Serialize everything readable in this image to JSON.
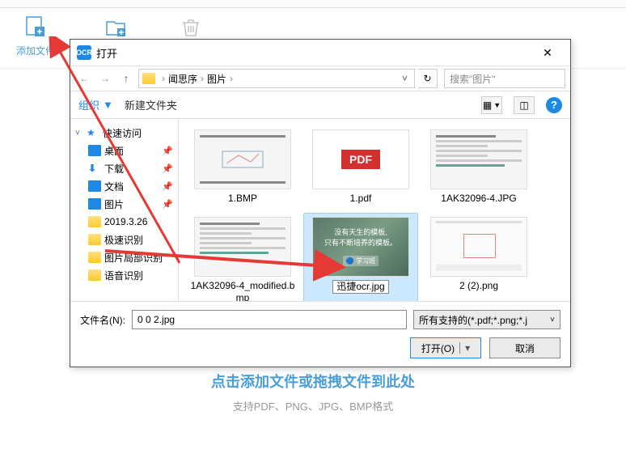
{
  "toolbar": {
    "add_file": "添加文件"
  },
  "background": {
    "main_text": "点击添加文件或拖拽文件到此处",
    "sub_text": "支持PDF、PNG、JPG、BMP格式"
  },
  "dialog": {
    "title": "打开",
    "close": "✕",
    "nav": {
      "back": "←",
      "forward": "→",
      "up": "↑"
    },
    "breadcrumb": {
      "seg1": "闻思序",
      "seg2": "图片"
    },
    "search_placeholder": "搜索\"图片\"",
    "organize": "组织",
    "new_folder": "新建文件夹",
    "sidebar": {
      "quick": "快速访问",
      "desktop": "桌面",
      "download": "下载",
      "documents": "文档",
      "pictures": "图片",
      "date": "2019.3.26",
      "fast": "极速识别",
      "partial": "图片局部识别",
      "voice": "语音识别"
    },
    "files": [
      {
        "name": "1.BMP",
        "kind": "image"
      },
      {
        "name": "1.pdf",
        "kind": "pdf"
      },
      {
        "name": "1AK32096-4.JPG",
        "kind": "textimg"
      },
      {
        "name": "1AK32096-4_modified.bmp",
        "kind": "textimg"
      },
      {
        "name": "迅捷ocr.jpg",
        "kind": "scenic"
      },
      {
        "name": "2 (2).png",
        "kind": "screenshot"
      }
    ],
    "filename_label": "文件名(N):",
    "filename_value": "0 0 2.jpg",
    "filetype": "所有支持的(*.pdf;*.png;*.j",
    "open_btn": "打开(O)",
    "cancel_btn": "取消"
  }
}
